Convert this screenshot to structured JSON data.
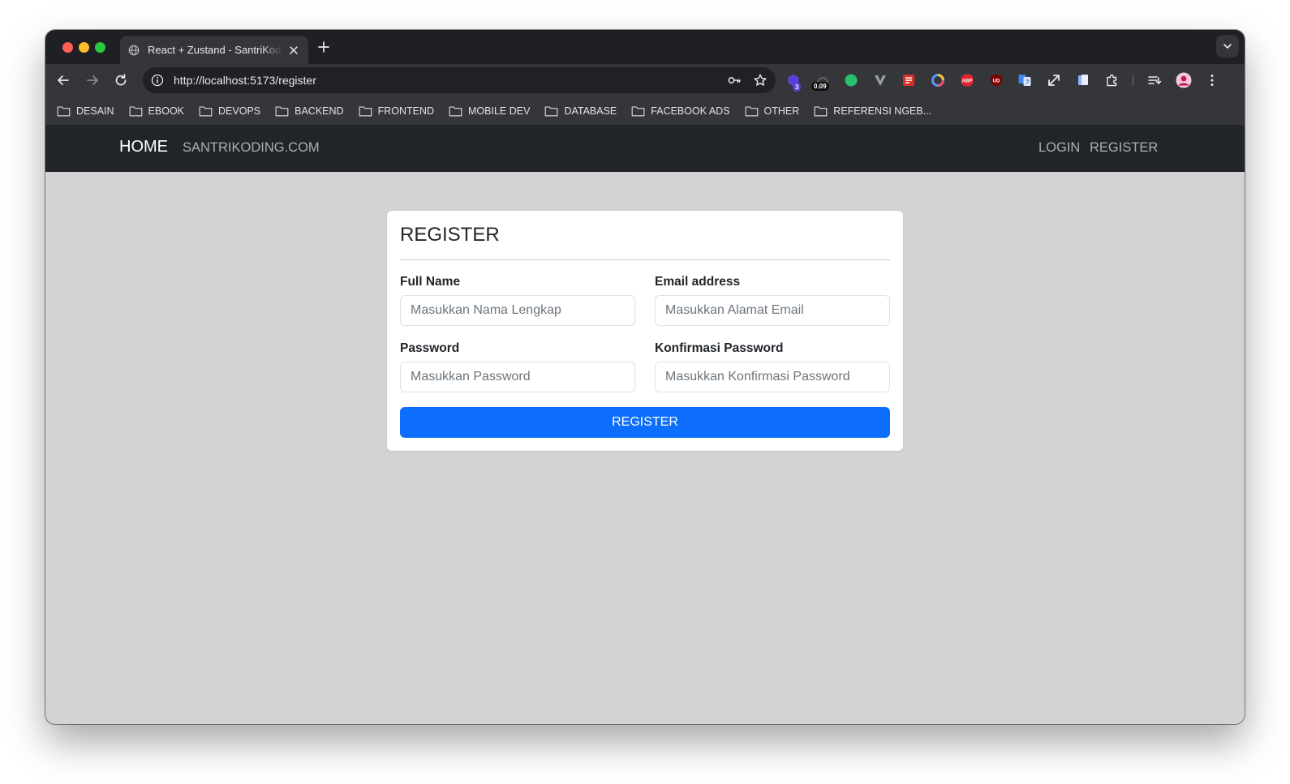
{
  "browser": {
    "tab_title": "React + Zustand - SantriKoding",
    "url": "http://localhost:5173/register",
    "extension_badges": {
      "count": "3",
      "value": "0.09",
      "abp": "ABP",
      "ud": "UD"
    },
    "bookmarks": [
      {
        "label": "DESAIN"
      },
      {
        "label": "EBOOK"
      },
      {
        "label": "DEVOPS"
      },
      {
        "label": "BACKEND"
      },
      {
        "label": "FRONTEND"
      },
      {
        "label": "MOBILE DEV"
      },
      {
        "label": "DATABASE"
      },
      {
        "label": "FACEBOOK ADS"
      },
      {
        "label": "OTHER"
      },
      {
        "label": "REFERENSI NGEB..."
      }
    ]
  },
  "navbar": {
    "brand": "HOME",
    "site_link": "SANTRIKODING.COM",
    "login": "LOGIN",
    "register": "REGISTER"
  },
  "form": {
    "title": "REGISTER",
    "full_name": {
      "label": "Full Name",
      "placeholder": "Masukkan Nama Lengkap",
      "value": ""
    },
    "email": {
      "label": "Email address",
      "placeholder": "Masukkan Alamat Email",
      "value": ""
    },
    "password": {
      "label": "Password",
      "placeholder": "Masukkan Password",
      "value": ""
    },
    "password_confirm": {
      "label": "Konfirmasi Password",
      "placeholder": "Masukkan Konfirmasi Password",
      "value": ""
    },
    "submit": "REGISTER"
  },
  "colors": {
    "navbar_bg": "#212529",
    "page_bg": "#d3d3d5",
    "primary": "#0d6efd"
  }
}
